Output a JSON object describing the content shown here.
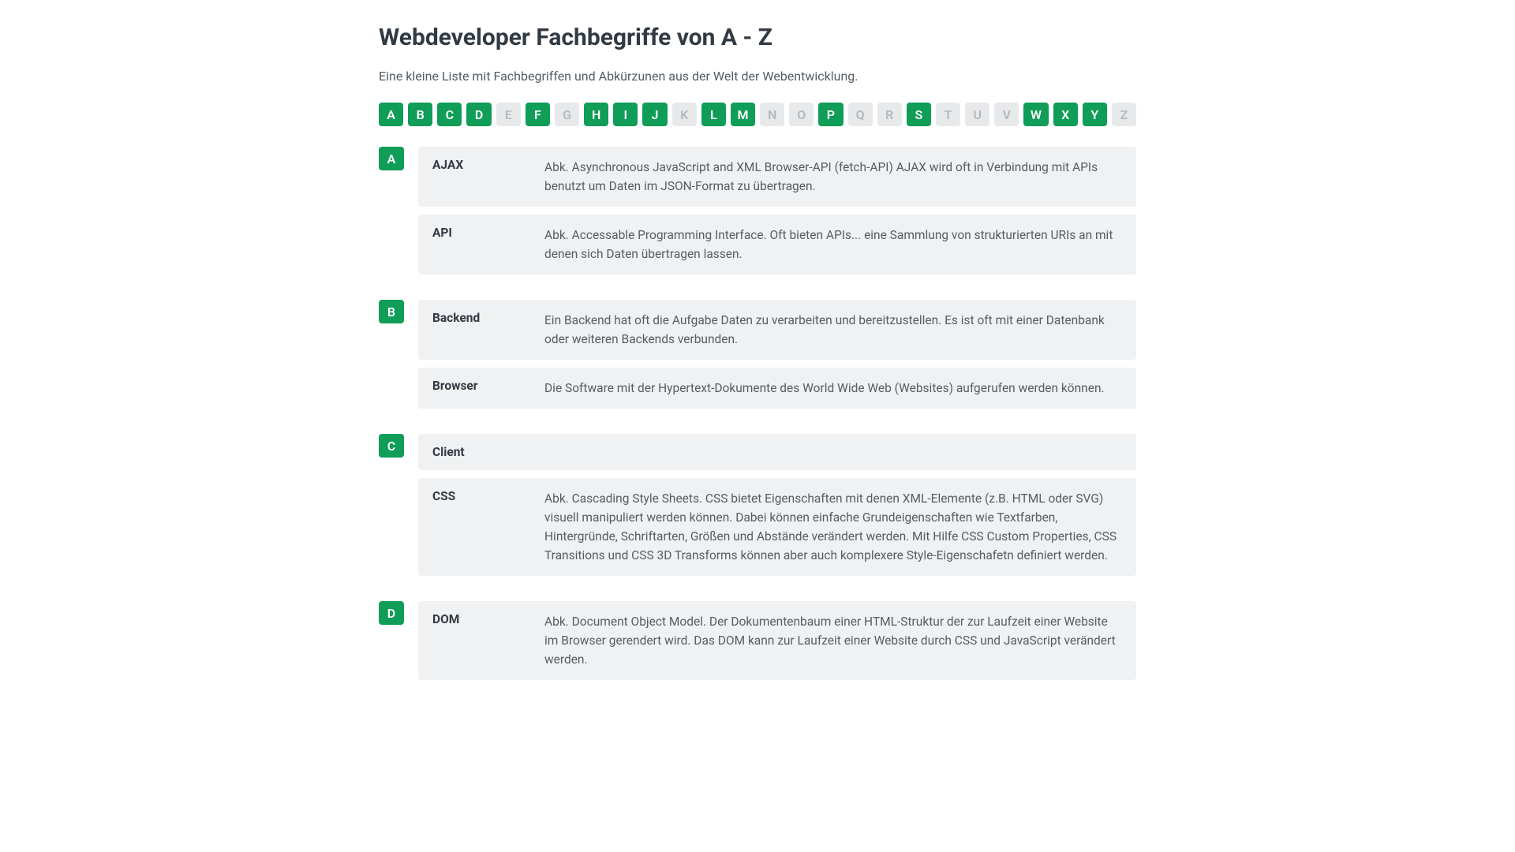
{
  "title": "Webdeveloper Fachbegriffe von A - Z",
  "intro": "Eine kleine Liste mit Fachbegriffen und Abkürzunen aus der Welt der Webentwicklung.",
  "letters": [
    {
      "char": "A",
      "active": true
    },
    {
      "char": "B",
      "active": true
    },
    {
      "char": "C",
      "active": true
    },
    {
      "char": "D",
      "active": true
    },
    {
      "char": "E",
      "active": false
    },
    {
      "char": "F",
      "active": true
    },
    {
      "char": "G",
      "active": false
    },
    {
      "char": "H",
      "active": true
    },
    {
      "char": "I",
      "active": true
    },
    {
      "char": "J",
      "active": true
    },
    {
      "char": "K",
      "active": false
    },
    {
      "char": "L",
      "active": true
    },
    {
      "char": "M",
      "active": true
    },
    {
      "char": "N",
      "active": false
    },
    {
      "char": "O",
      "active": false
    },
    {
      "char": "P",
      "active": true
    },
    {
      "char": "Q",
      "active": false
    },
    {
      "char": "R",
      "active": false
    },
    {
      "char": "S",
      "active": true
    },
    {
      "char": "T",
      "active": false
    },
    {
      "char": "U",
      "active": false
    },
    {
      "char": "V",
      "active": false
    },
    {
      "char": "W",
      "active": true
    },
    {
      "char": "X",
      "active": true
    },
    {
      "char": "Y",
      "active": true
    },
    {
      "char": "Z",
      "active": false
    }
  ],
  "sections": [
    {
      "letter": "A",
      "entries": [
        {
          "term": "AJAX",
          "def": "Abk. Asynchronous JavaScript and XML\nBrowser-API (fetch-API) AJAX wird oft in Verbindung mit APIs benutzt um Daten im JSON-Format zu übertragen."
        },
        {
          "term": "API",
          "def": "Abk. Accessable Programming Interface. Oft bieten APIs... eine Sammlung von strukturierten URIs an mit denen sich Daten übertragen lassen."
        }
      ]
    },
    {
      "letter": "B",
      "entries": [
        {
          "term": "Backend",
          "def": "Ein Backend hat oft die Aufgabe Daten zu verarbeiten und bereitzustellen. Es ist oft mit einer Datenbank oder weiteren Backends verbunden."
        },
        {
          "term": "Browser",
          "def": "Die Software mit der Hypertext-Dokumente des World Wide Web (Websites) aufgerufen werden können."
        }
      ]
    },
    {
      "letter": "C",
      "entries": [
        {
          "term": "Client",
          "def": ""
        },
        {
          "term": "CSS",
          "def": "Abk. Cascading Style Sheets. CSS bietet Eigenschaften mit denen XML-Elemente (z.B. HTML oder SVG) visuell manipuliert werden können. Dabei können einfache Grundeigenschaften wie Textfarben, Hintergründe, Schriftarten, Größen und Abstände verändert werden. Mit Hilfe CSS Custom Properties, CSS Transitions und CSS 3D Transforms können aber auch komplexere Style-Eigenschafetn definiert werden."
        }
      ]
    },
    {
      "letter": "D",
      "entries": [
        {
          "term": "DOM",
          "def": "Abk. Document Object Model. Der Dokumentenbaum einer HTML-Struktur der zur Laufzeit einer Website im Browser gerendert wird. Das DOM kann zur Laufzeit einer Website durch CSS und JavaScript verändert werden."
        }
      ]
    }
  ]
}
